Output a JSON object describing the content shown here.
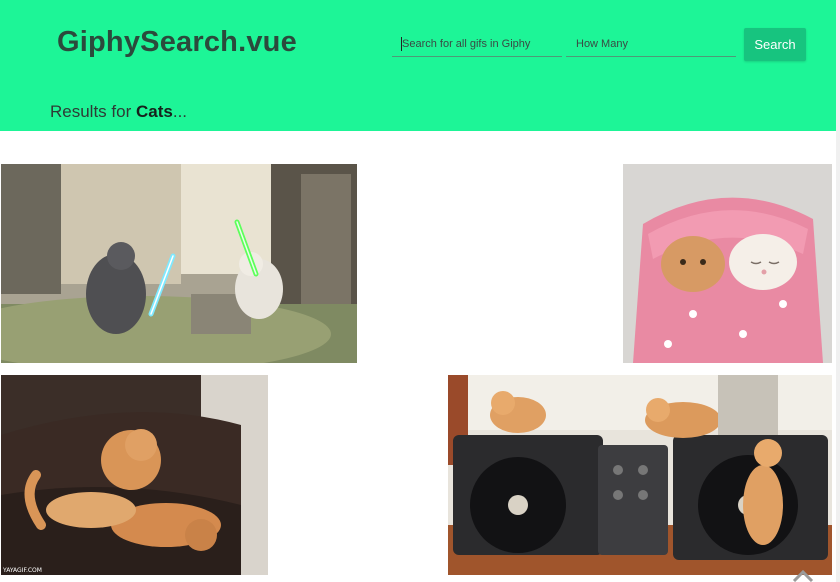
{
  "header": {
    "brand": "GiphySearch.vue",
    "search_placeholder": "Search for all gifs in Giphy",
    "count_placeholder": "How Many",
    "search_button": "Search"
  },
  "results": {
    "prefix": "Results for ",
    "query": "Cats",
    "suffix": "..."
  },
  "gifs": [
    {
      "name": "cats-lightsaber-duel"
    },
    {
      "name": "cats-in-pink-blanket"
    },
    {
      "name": "kittens-wrestling-on-couch",
      "watermark": "YAYAGIF.COM"
    },
    {
      "name": "kittens-on-turntables"
    }
  ],
  "colors": {
    "header_bg": "#1df597",
    "button_bg": "#17c47f"
  }
}
